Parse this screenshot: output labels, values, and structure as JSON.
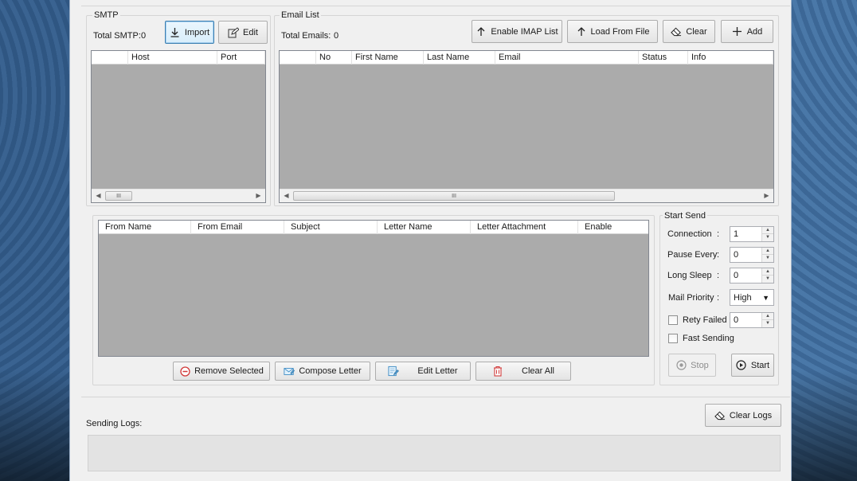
{
  "smtp": {
    "title": "SMTP",
    "total_label": "Total SMTP:",
    "total_value": "0",
    "import_label": "Import",
    "edit_label": "Edit",
    "columns": [
      "Host",
      "Port"
    ]
  },
  "email_list": {
    "title": "Email List",
    "total_label": "Total Emails:",
    "total_value": "0",
    "enable_imap_label": "Enable IMAP List",
    "load_from_file_label": "Load From File",
    "clear_label": "Clear",
    "add_label": "Add",
    "columns": [
      "No",
      "First Name",
      "Last Name",
      "Email",
      "Status",
      "Info"
    ]
  },
  "letters": {
    "columns": [
      "From Name",
      "From Email",
      "Subject",
      "Letter Name",
      "Letter Attachment",
      "Enable"
    ],
    "remove_selected_label": "Remove Selected",
    "compose_letter_label": "Compose Letter",
    "edit_letter_label": "Edit Letter",
    "clear_all_label": "Clear All"
  },
  "start_send": {
    "title": "Start Send",
    "connection_label": "Connection",
    "connection_value": "1",
    "pause_every_label": "Pause Every",
    "pause_every_value": "0",
    "long_sleep_label": "Long Sleep",
    "long_sleep_value": "0",
    "mail_priority_label": "Mail Priority",
    "mail_priority_value": "High",
    "retry_failed_label": "Rety Failed",
    "retry_failed_value": "0",
    "fast_sending_label": "Fast Sending",
    "colon": ":",
    "stop_label": "Stop",
    "start_label": "Start"
  },
  "logs": {
    "title": "Sending Logs:",
    "clear_logs_label": "Clear Logs"
  },
  "scroll_grip": "III"
}
